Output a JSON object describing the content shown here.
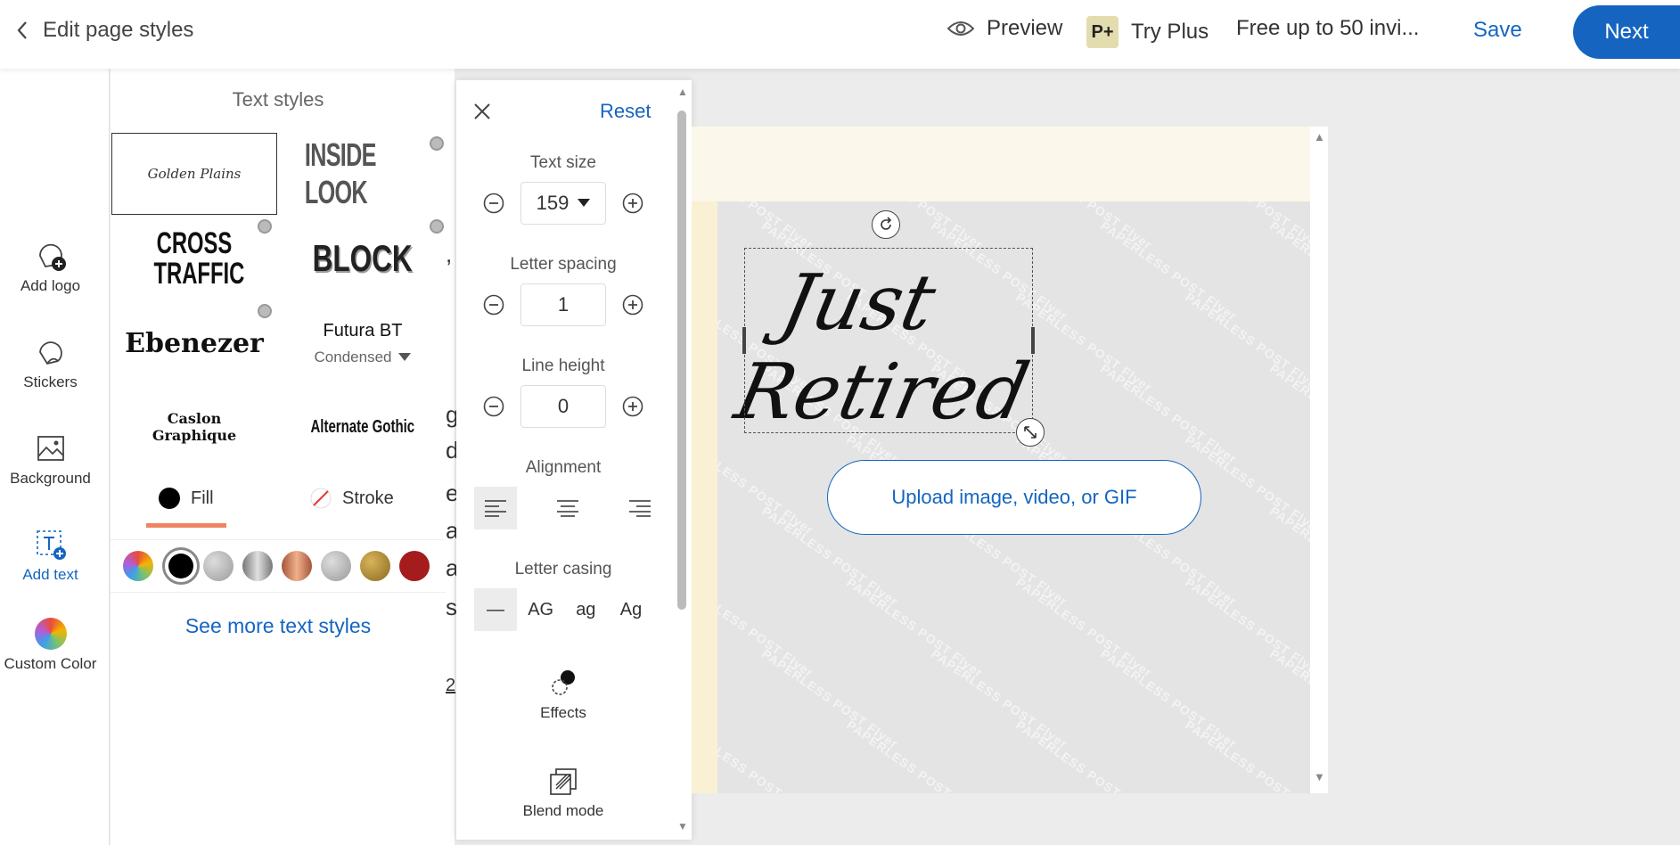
{
  "topbar": {
    "back_label": "Edit page styles",
    "preview_label": "Preview",
    "plus_badge": "P+",
    "try_plus_label": "Try Plus",
    "free_label": "Free up to 50 invi...",
    "save_label": "Save",
    "next_label": "Next"
  },
  "rail": {
    "items": [
      {
        "label": "Add logo",
        "icon": "add-logo-icon"
      },
      {
        "label": "Stickers",
        "icon": "sticker-icon"
      },
      {
        "label": "Background",
        "icon": "image-icon"
      },
      {
        "label": "Add text",
        "icon": "add-text-icon"
      },
      {
        "label": "Custom Color",
        "icon": "color-wheel-icon"
      }
    ]
  },
  "styles": {
    "title": "Text styles",
    "tiles": [
      "Golden Plains",
      "INSIDE LOOK",
      "CROSS TRAFFIC",
      "BLOCK",
      "Ebenezer",
      "Futura BT",
      "Caslon Graphique",
      "Alternate Gothic"
    ],
    "futura_variant": "Condensed",
    "fill_label": "Fill",
    "stroke_label": "Stroke",
    "see_more": "See more text styles",
    "swatch_colors": [
      "#000000",
      "#b9b9b9",
      "#9a9a9a",
      "#c9805e",
      "#a8a8a8",
      "#a88a3a",
      "#a41c1c"
    ]
  },
  "panel": {
    "reset_label": "Reset",
    "text_size_label": "Text size",
    "text_size_value": "159",
    "letter_spacing_label": "Letter spacing",
    "letter_spacing_value": "1",
    "line_height_label": "Line height",
    "line_height_value": "0",
    "alignment_label": "Alignment",
    "casing_label": "Letter casing",
    "casing_options": [
      "—",
      "AG",
      "ag",
      "Ag"
    ],
    "effects_label": "Effects",
    "blend_label": "Blend mode"
  },
  "canvas": {
    "line1": "Just",
    "line2": "Retired",
    "upload_label": "Upload image, video, or GIF",
    "watermark": "PAPERLESS POST Flyer",
    "edge_chars": [
      ",",
      "g",
      "d",
      "e",
      "a",
      "a",
      "s",
      "2"
    ]
  }
}
